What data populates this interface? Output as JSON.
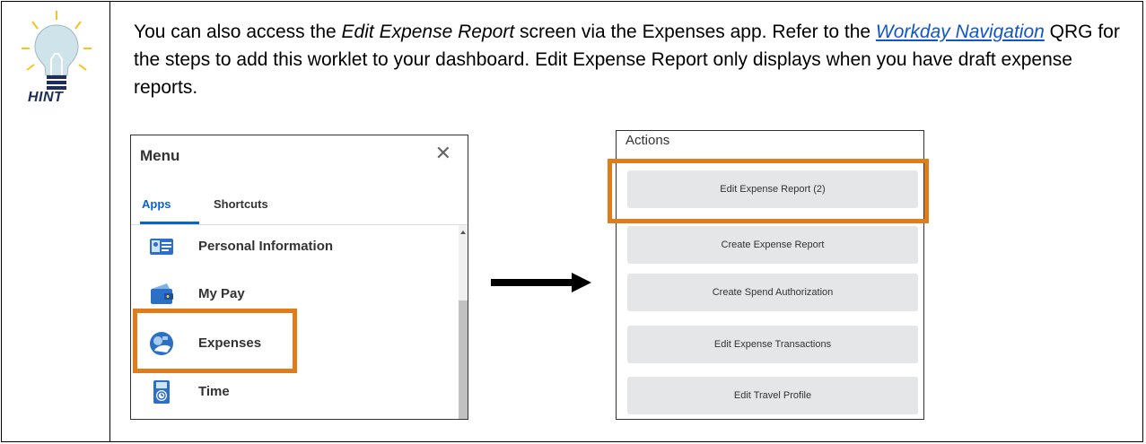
{
  "hint": {
    "label": "HINT"
  },
  "paragraph": {
    "part1": "You can also access the ",
    "italic": "Edit Expense Report",
    "part2": " screen via the Expenses app.  Refer to the ",
    "link": "Workday Navigation",
    "part3": " QRG for the steps to add this worklet to your dashboard. Edit Expense Report only displays when you have draft expense reports."
  },
  "menu": {
    "title": "Menu",
    "tabs": [
      "Apps",
      "Shortcuts"
    ],
    "items": [
      "Personal Information",
      "My Pay",
      "Expenses",
      "Time"
    ]
  },
  "actions": {
    "title": "Actions",
    "buttons": [
      "Edit Expense Report (2)",
      "Create Expense Report",
      "Create Spend Authorization",
      "Edit Expense Transactions",
      "Edit Travel Profile"
    ]
  },
  "colors": {
    "highlight": "#e07c1a",
    "link": "#1155cc",
    "tab_active": "#0b63c8"
  },
  "icons": {
    "close": "close-icon",
    "bulb": "lightbulb-icon",
    "arrow": "right-arrow-icon"
  }
}
